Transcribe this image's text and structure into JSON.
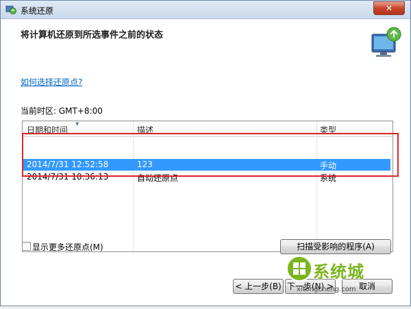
{
  "window": {
    "title": "系统还原",
    "close_label": "✕"
  },
  "heading": "将计算机还原到所选事件之前的状态",
  "help_link": "如何选择还原点?",
  "timezone": "当前时区: GMT+8:00",
  "table": {
    "columns": [
      "日期和时间",
      "描述",
      "类型"
    ],
    "rows": [
      {
        "datetime": "2014/7/31 12:52:58",
        "description": "123",
        "type": "手动",
        "selected": true
      },
      {
        "datetime": "2014/7/31 10:36:13",
        "description": "自动还原点",
        "type": "系统",
        "selected": false
      }
    ]
  },
  "show_more": {
    "label": "显示更多还原点(M)",
    "checked": false
  },
  "buttons": {
    "scan": "扫描受影响的程序(A)",
    "back": "< 上一步(B)",
    "next": "下一步(N) >",
    "cancel": "取消"
  },
  "watermark": {
    "text": "系统城",
    "url": "xitongcheng.com"
  },
  "colors": {
    "selection": "#3399ff",
    "highlight_box": "#e0202a",
    "link": "#0066cc",
    "watermark": "#7ab51d"
  }
}
